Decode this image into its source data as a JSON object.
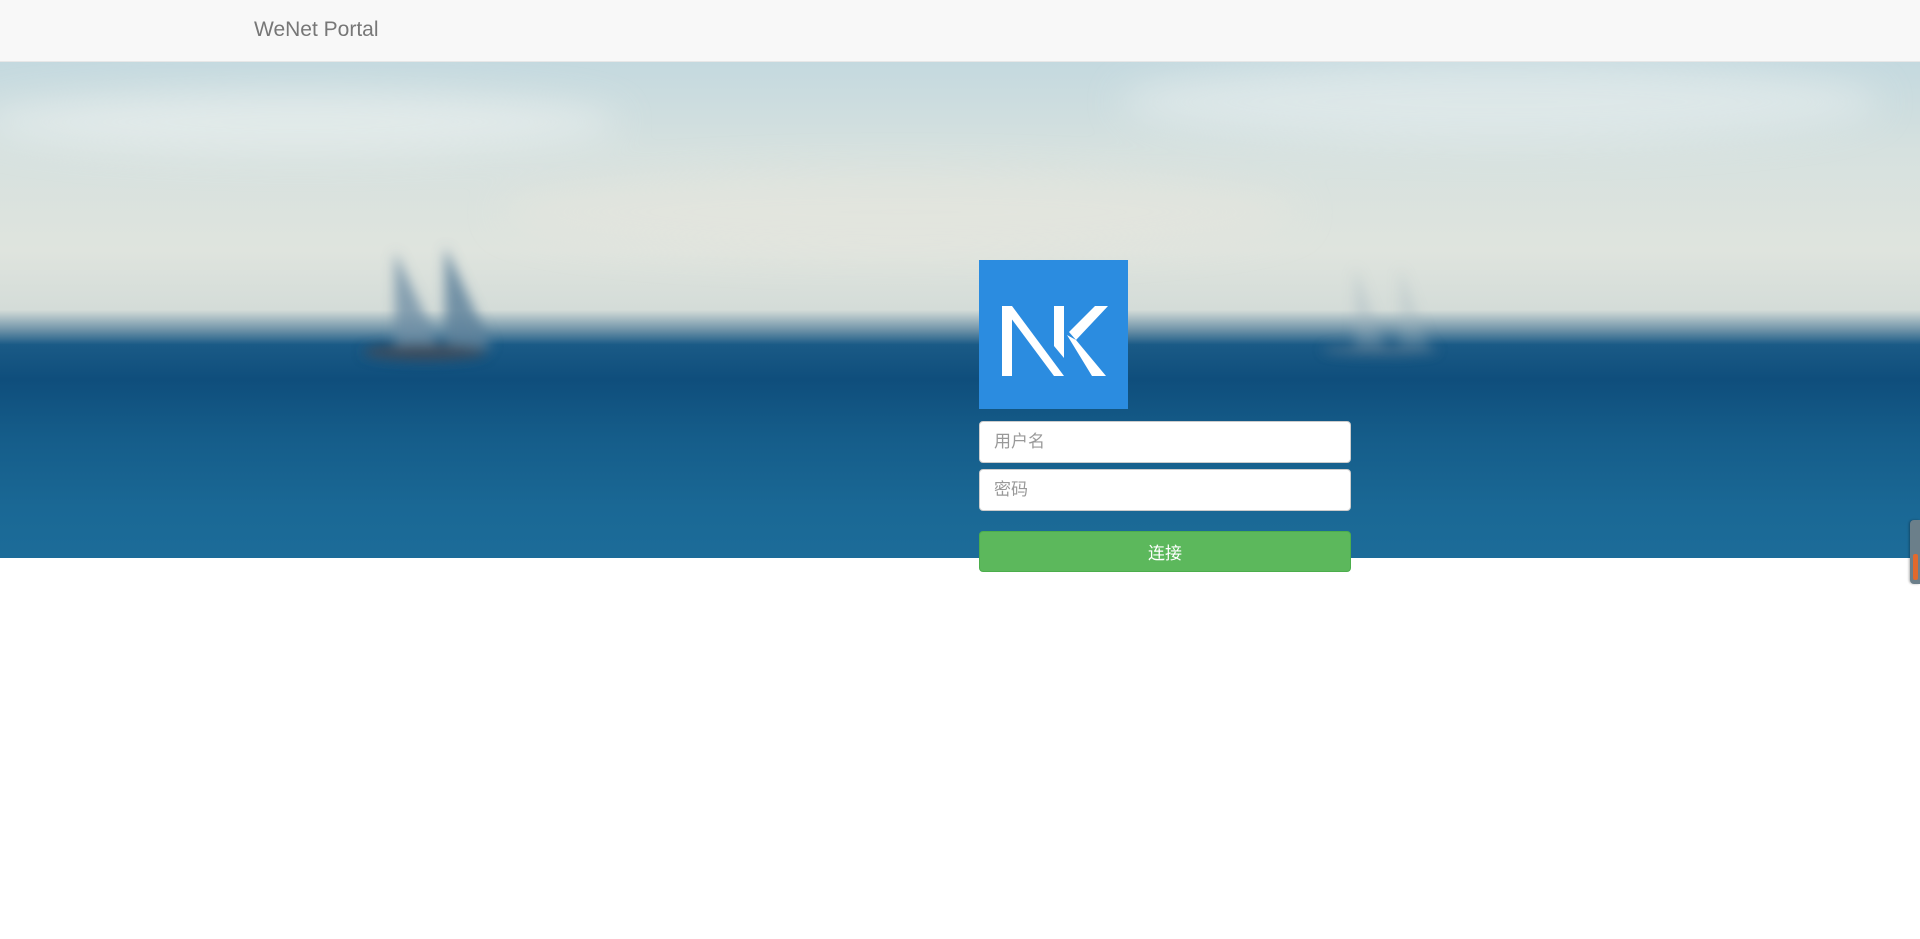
{
  "navbar": {
    "brand": "WeNet Portal"
  },
  "login": {
    "logo_icon": "nk-logo-icon",
    "username": {
      "placeholder": "用户名",
      "value": ""
    },
    "password": {
      "placeholder": "密码",
      "value": ""
    },
    "connect_label": "连接"
  },
  "colors": {
    "logo_bg": "#2b8ce0",
    "button": "#5cb85c",
    "navbar_bg": "#f8f8f8"
  }
}
